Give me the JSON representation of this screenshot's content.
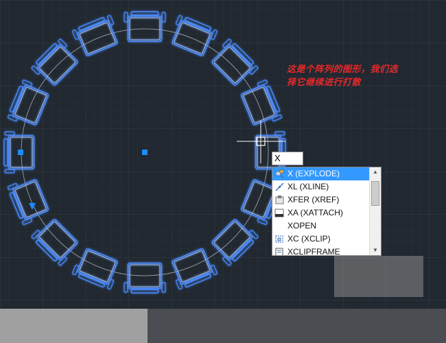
{
  "annotation": {
    "line1": "这是个阵列的图形，我们选",
    "line2": "择它继续进行打散"
  },
  "command_input": {
    "value": "X"
  },
  "autocomplete": {
    "items": [
      {
        "label": "X (EXPLODE)",
        "icon": "explode-icon",
        "selected": true
      },
      {
        "label": "XL (XLINE)",
        "icon": "xline-icon",
        "selected": false
      },
      {
        "label": "XFER (XREF)",
        "icon": "xref-icon",
        "selected": false
      },
      {
        "label": "XA (XATTACH)",
        "icon": "xattach-icon",
        "selected": false
      },
      {
        "label": "XOPEN",
        "icon": "",
        "selected": false
      },
      {
        "label": "XC (XCLIP)",
        "icon": "xclip-icon",
        "selected": false
      },
      {
        "label": "XCLIPFRAME",
        "icon": "xclipframe-icon",
        "selected": false
      }
    ]
  },
  "colors": {
    "background": "#212830",
    "grid": "#2c3640",
    "chair_stroke": "#4a8cff",
    "chair_glow": "#3c78ff",
    "selection_accent": "#3399ff",
    "annotation": "#e8282a",
    "grip": "#1a8cff"
  }
}
